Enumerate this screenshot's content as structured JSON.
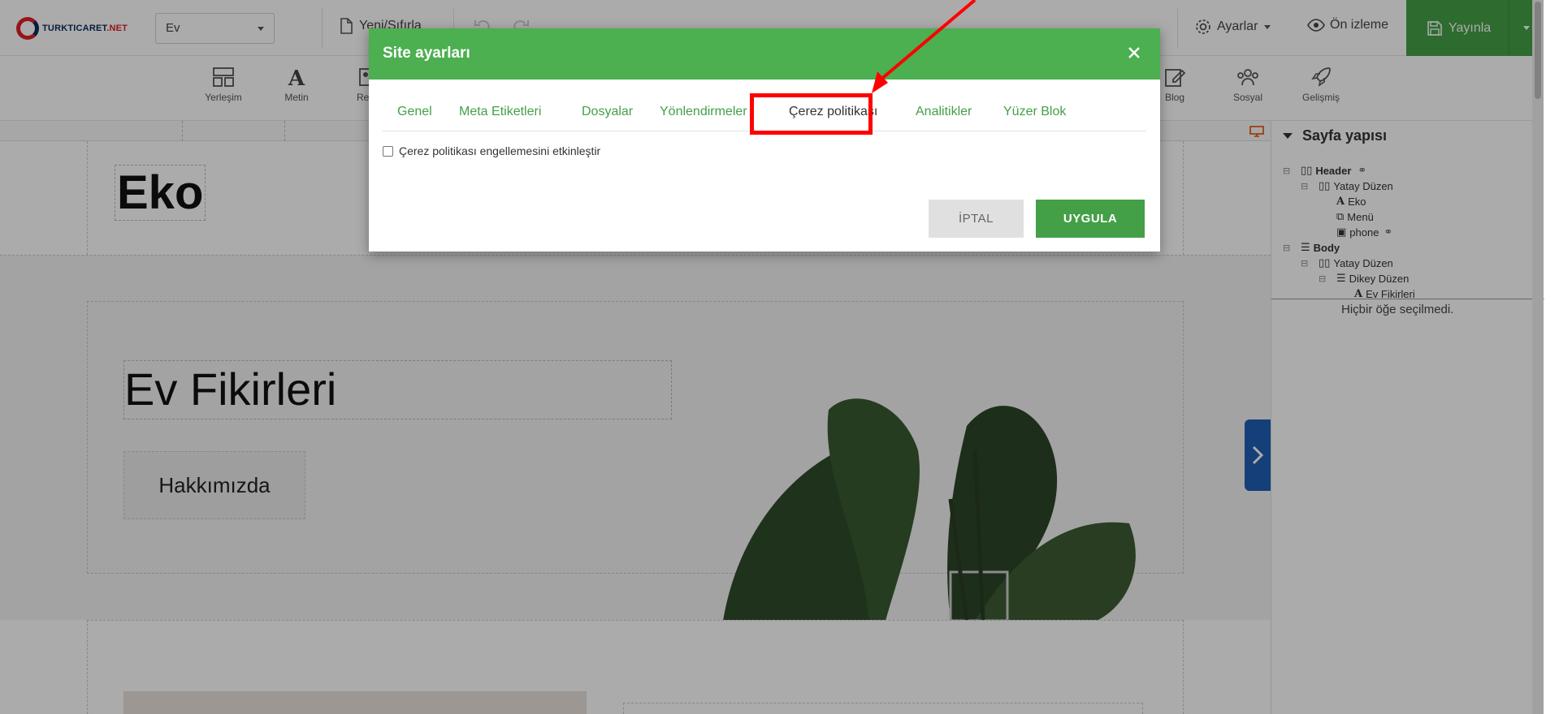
{
  "topbar": {
    "logo_text": "TURKTICARET",
    "logo_suffix": ".NET",
    "page_select_value": "Ev",
    "new_reset_label": "Yeni/Sıfırla",
    "settings_label": "Ayarlar",
    "preview_label": "Ön izleme",
    "publish_label": "Yayınla"
  },
  "toolbar": {
    "items": [
      {
        "label": "Yerleşim",
        "icon": "layout-icon"
      },
      {
        "label": "Metin",
        "icon": "text-icon"
      },
      {
        "label": "Re",
        "icon": "image-icon"
      },
      {
        "label": "Blog",
        "icon": "blog-icon"
      },
      {
        "label": "Sosyal",
        "icon": "social-icon"
      },
      {
        "label": "Gelişmiş",
        "icon": "rocket-icon"
      }
    ]
  },
  "canvas": {
    "logo_text": "Eko",
    "hero_title": "Ev Fikirleri",
    "about_button": "Hakkımızda"
  },
  "right_panel": {
    "title": "Sayfa yapısı",
    "tree": [
      {
        "label": "Header",
        "bold": true
      },
      {
        "label": "Yatay Düzen"
      },
      {
        "label": "Eko"
      },
      {
        "label": "Menü"
      },
      {
        "label": "phone"
      },
      {
        "label": "Body",
        "bold": true
      },
      {
        "label": "Yatay Düzen"
      },
      {
        "label": "Dikey Düzen"
      },
      {
        "label": "Ev Fikirleri"
      }
    ],
    "no_selection": "Hiçbir öğe seçilmedi."
  },
  "modal": {
    "title": "Site ayarları",
    "tabs": [
      {
        "label": "Genel"
      },
      {
        "label": "Meta Etiketleri"
      },
      {
        "label": "Dosyalar"
      },
      {
        "label": "Yönlendirmeler"
      },
      {
        "label": "Çerez politikası",
        "active": true
      },
      {
        "label": "Analitikler"
      },
      {
        "label": "Yüzer Blok"
      }
    ],
    "cookie_checkbox_label": "Çerez politikası engellemesini etkinleştir",
    "cookie_checkbox_checked": false,
    "cancel_label": "İPTAL",
    "apply_label": "UYGULA"
  },
  "colors": {
    "accent": "#4caf50",
    "annotation": "#ff0000",
    "panel_toggle": "#1e5fb4"
  }
}
